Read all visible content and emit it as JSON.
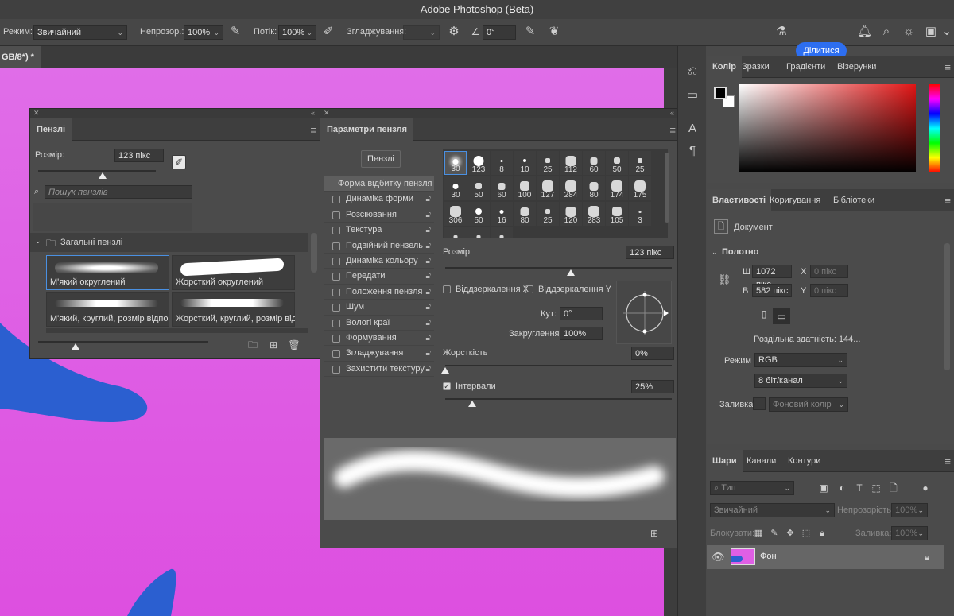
{
  "app": {
    "title": "Adobe Photoshop (Beta)"
  },
  "options": {
    "mode_label": "Режим:",
    "mode_value": "Звичайний",
    "opacity_label": "Непрозор.:",
    "opacity_value": "100%",
    "flow_label": "Потік:",
    "flow_value": "100%",
    "smoothing_label": "Згладжування:",
    "angle_value": "0°",
    "share_label": "Ділитися"
  },
  "document": {
    "tab_label": "GB/8*) *"
  },
  "brushes_panel": {
    "tab": "Пензлі",
    "size_label": "Розмір:",
    "size_value": "123 пікс",
    "search_placeholder": "Пошук пензлів",
    "group_name": "Загальні пензлі",
    "brushes": [
      {
        "name": "М'який округлений"
      },
      {
        "name": "Жорсткий округлений"
      },
      {
        "name": "М'який, круглий, розмір відпо..."
      },
      {
        "name": "Жорсткий, круглий, розмір від..."
      }
    ]
  },
  "brush_settings": {
    "tab": "Параметри пензля",
    "brushes_button": "Пензлі",
    "items": [
      {
        "label": "Форма відбитку пензля",
        "active": true
      },
      {
        "label": "Динаміка форми"
      },
      {
        "label": "Розсіювання"
      },
      {
        "label": "Текстура"
      },
      {
        "label": "Подвійний пензель"
      },
      {
        "label": "Динаміка кольору"
      },
      {
        "label": "Передати"
      },
      {
        "label": "Положення пензля"
      },
      {
        "label": "Шум"
      },
      {
        "label": "Вологі краї"
      },
      {
        "label": "Формування"
      },
      {
        "label": "Згладжування"
      },
      {
        "label": "Захистити текстуру"
      }
    ],
    "tips": [
      "30",
      "123",
      "8",
      "10",
      "25",
      "112",
      "60",
      "50",
      "25",
      "30",
      "50",
      "60",
      "100",
      "127",
      "284",
      "80",
      "174",
      "175",
      "306",
      "50",
      "16",
      "80",
      "25",
      "120",
      "283",
      "105",
      "3",
      "",
      "",
      ""
    ],
    "size_label": "Розмір",
    "size_value": "123 пікс",
    "flip_x": "Віддзеркалення X",
    "flip_y": "Віддзеркалення Y",
    "angle_label": "Кут:",
    "angle_value": "0°",
    "roundness_label": "Закруглення:",
    "roundness_value": "100%",
    "hardness_label": "Жорсткість",
    "hardness_value": "0%",
    "spacing_label": "Інтервали",
    "spacing_value": "25%"
  },
  "color_panel": {
    "tabs": [
      "Колір",
      "Зразки",
      "Градієнти",
      "Візерунки"
    ]
  },
  "properties_panel": {
    "tabs": [
      "Властивості",
      "Коригування",
      "Бібліотеки"
    ],
    "doc_label": "Документ",
    "section": "Полотно",
    "w_label": "Ш",
    "w_value": "1072 пікс",
    "h_label": "В",
    "h_value": "582 пікс",
    "x_label": "X",
    "x_placeholder": "0 пікс",
    "y_label": "Y",
    "y_placeholder": "0 пікс",
    "resolution": "Роздільна здатність: 144...",
    "mode_label": "Режим",
    "mode_value": "RGB",
    "depth_value": "8 біт/канал",
    "fill_label": "Заливка",
    "fill_value": "Фоновий колір"
  },
  "layers_panel": {
    "tabs": [
      "Шари",
      "Канали",
      "Контури"
    ],
    "filter_placeholder": "Тип",
    "blend_value": "Звичайний",
    "opacity_label": "Непрозорість:",
    "opacity_value": "100%",
    "lock_label": "Блокувати:",
    "fill_label": "Заливка:",
    "fill_value": "100%",
    "layer_name": "Фон"
  },
  "colors": {
    "accent": "#2d6ef0",
    "canvas": "#df5fe5",
    "shape": "#2b5fd0"
  }
}
